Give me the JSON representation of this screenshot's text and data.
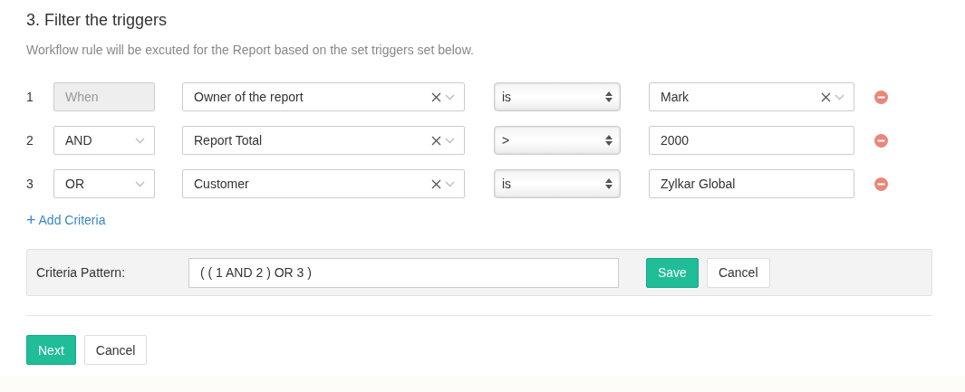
{
  "title": "3. Filter the triggers",
  "description": "Workflow rule will be excuted for the Report based on the set triggers set below.",
  "rows": [
    {
      "number": "1",
      "connector": {
        "label": "When",
        "disabled": true
      },
      "field": {
        "value": "Owner of the report"
      },
      "operator": "is",
      "value": {
        "kind": "select",
        "text": "Mark"
      }
    },
    {
      "number": "2",
      "connector": {
        "label": "AND",
        "disabled": false
      },
      "field": {
        "value": "Report Total"
      },
      "operator": ">",
      "value": {
        "kind": "text",
        "text": "2000"
      }
    },
    {
      "number": "3",
      "connector": {
        "label": "OR",
        "disabled": false
      },
      "field": {
        "value": "Customer"
      },
      "operator": "is",
      "value": {
        "kind": "text",
        "text": "Zylkar Global"
      }
    }
  ],
  "add_criteria": {
    "icon": "+",
    "label": "Add Criteria"
  },
  "criteria_pattern": {
    "label": "Criteria Pattern:",
    "value": "( ( 1 AND 2 ) OR 3 )",
    "save": "Save",
    "cancel": "Cancel"
  },
  "footer": {
    "next": "Next",
    "cancel": "Cancel"
  }
}
